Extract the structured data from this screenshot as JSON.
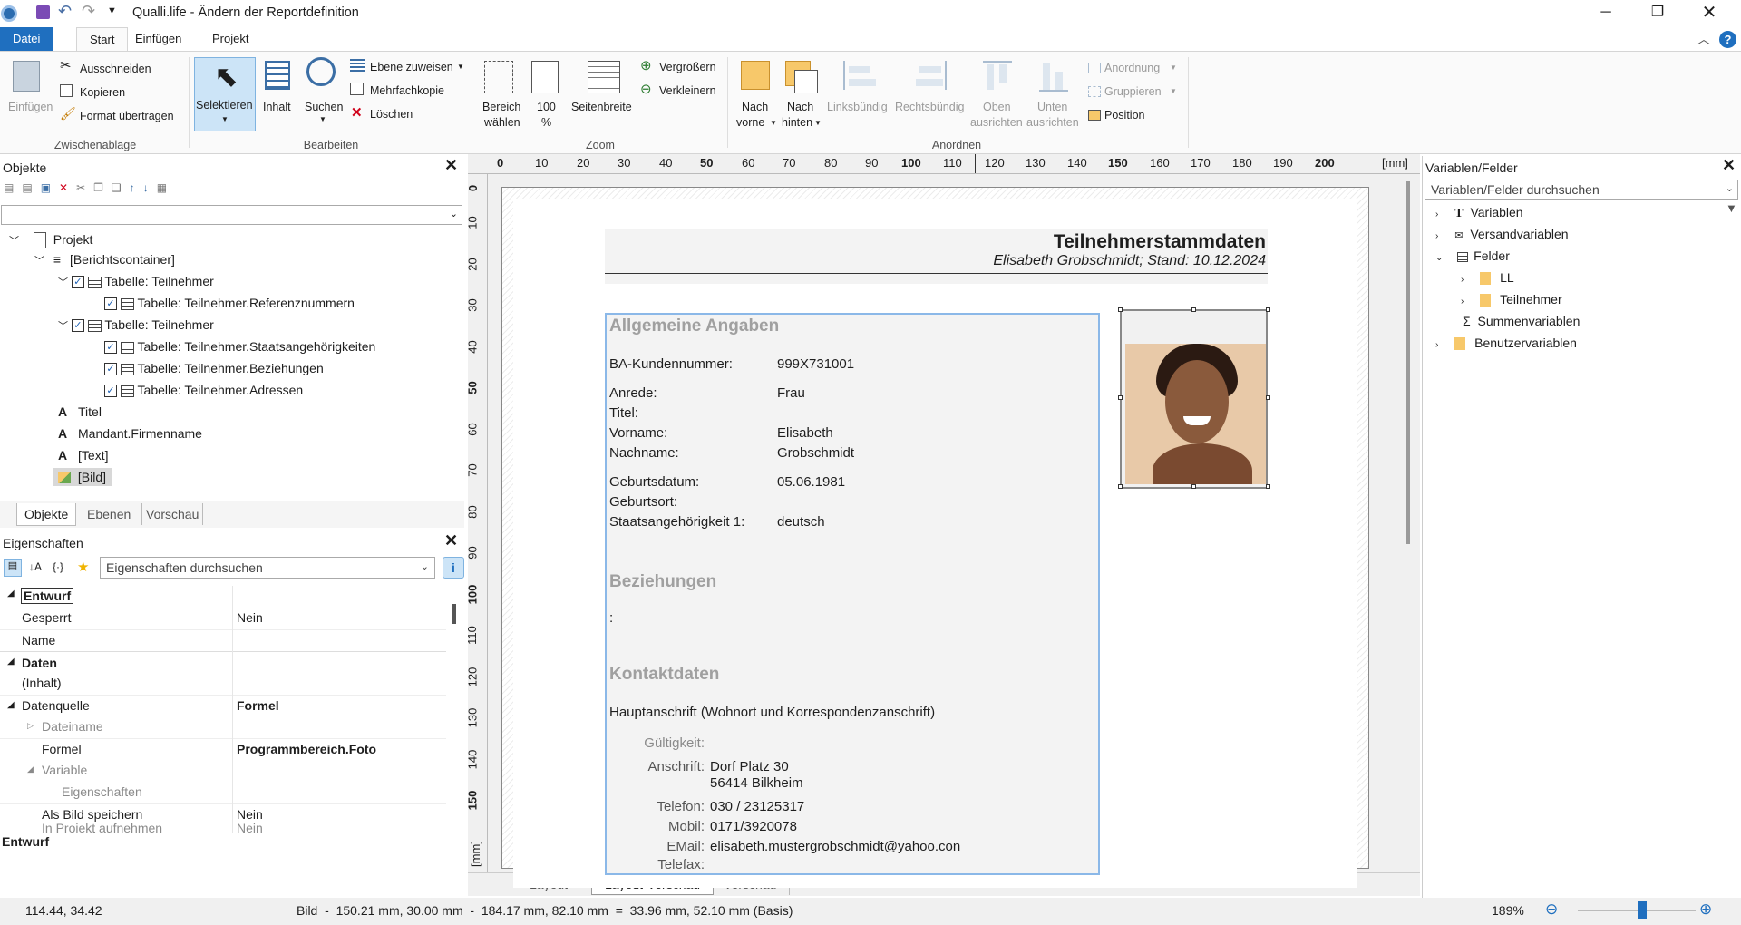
{
  "window": {
    "title": "Qualli.life - Ändern der Reportdefinition"
  },
  "tabs": [
    "Datei",
    "Start",
    "Einfügen",
    "Projekt"
  ],
  "ribbon": {
    "clipboard": {
      "paste": "Einfügen",
      "cut": "Ausschneiden",
      "copy": "Kopieren",
      "format": "Format übertragen",
      "group": "Zwischenablage"
    },
    "edit": {
      "select": "Selektieren",
      "content": "Inhalt",
      "search": "Suchen",
      "assign_layer": "Ebene zuweisen",
      "multi_copy": "Mehrfachkopie",
      "delete": "Löschen",
      "group": "Bearbeiten"
    },
    "zoom": {
      "area1": "Bereich",
      "area2": "wählen",
      "pct1": "100",
      "pct2": "%",
      "pagewidth": "Seitenbreite",
      "zoomin": "Vergrößern",
      "zoomout": "Verkleinern",
      "group": "Zoom"
    },
    "arrange": {
      "front1": "Nach",
      "front2": "vorne",
      "back1": "Nach",
      "back2": "hinten",
      "left": "Linksbündig",
      "right": "Rechtsbündig",
      "top1": "Oben",
      "top2": "ausrichten",
      "bottom1": "Unten",
      "bottom2": "ausrichten",
      "arrangement": "Anordnung",
      "grouping": "Gruppieren",
      "position": "Position",
      "group": "Anordnen"
    }
  },
  "objects": {
    "title": "Objekte",
    "tree": [
      "Projekt",
      "[Berichtscontainer]",
      "Tabelle: Teilnehmer",
      "Tabelle: Teilnehmer.Referenznummern",
      "Tabelle: Teilnehmer",
      "Tabelle: Teilnehmer.Staatsangehörigkeiten",
      "Tabelle: Teilnehmer.Beziehungen",
      "Tabelle: Teilnehmer.Adressen",
      "Titel",
      "Mandant.Firmenname",
      "[Text]",
      "[Bild]"
    ],
    "tabs": [
      "Objekte",
      "Ebenen",
      "Vorschau"
    ]
  },
  "properties": {
    "title": "Eigenschaften",
    "search_placeholder": "Eigenschaften durchsuchen",
    "rows": [
      {
        "k": "Entwurf",
        "v": ""
      },
      {
        "k": "Gesperrt",
        "v": "Nein"
      },
      {
        "k": "Name",
        "v": ""
      },
      {
        "k": "Daten",
        "v": ""
      },
      {
        "k": "(Inhalt)",
        "v": ""
      },
      {
        "k": "Datenquelle",
        "v": "Formel"
      },
      {
        "k": "Dateiname",
        "v": ""
      },
      {
        "k": "Formel",
        "v": "Programmbereich.Foto"
      },
      {
        "k": "Variable",
        "v": ""
      },
      {
        "k": "Eigenschaften",
        "v": ""
      },
      {
        "k": "Als Bild speichern",
        "v": "Nein"
      },
      {
        "k": "In Projekt aufnehmen",
        "v": "Nein"
      }
    ],
    "footer": "Entwurf"
  },
  "ruler": {
    "unit": "[mm]",
    "h": [
      "0",
      "10",
      "20",
      "30",
      "40",
      "50",
      "60",
      "70",
      "80",
      "90",
      "100",
      "110",
      "120",
      "130",
      "140",
      "150",
      "160",
      "170",
      "180",
      "190",
      "200"
    ],
    "v": [
      "0",
      "10",
      "20",
      "30",
      "40",
      "50",
      "60",
      "70",
      "80",
      "90",
      "100",
      "110",
      "120",
      "130",
      "140",
      "150"
    ]
  },
  "report": {
    "title": "Teilnehmerstammdaten",
    "subtitle": "Elisabeth Grobschmidt; Stand: 10.12.2024",
    "sec1": "Allgemeine Angaben",
    "fields": [
      {
        "k": "BA-Kundennummer:",
        "v": "999X731001"
      },
      {
        "k": "Anrede:",
        "v": "Frau"
      },
      {
        "k": "Titel:",
        "v": ""
      },
      {
        "k": "Vorname:",
        "v": "Elisabeth"
      },
      {
        "k": "Nachname:",
        "v": "Grobschmidt"
      },
      {
        "k": "Geburtsdatum:",
        "v": "05.06.1981"
      },
      {
        "k": "Geburtsort:",
        "v": ""
      },
      {
        "k": "Staatsangehörigkeit 1:",
        "v": "deutsch"
      }
    ],
    "sec2": "Beziehungen",
    "colon": ":",
    "sec3": "Kontaktdaten",
    "address_type": "Hauptanschrift (Wohnort und Korrespondenzanschrift)",
    "contact": [
      {
        "k": "Gültigkeit:",
        "v": ""
      },
      {
        "k": "Anschrift:",
        "v": "Dorf Platz 30"
      },
      {
        "k": "",
        "v": "56414 Bilkheim"
      },
      {
        "k": "Telefon:",
        "v": "030 / 23125317"
      },
      {
        "k": "Mobil:",
        "v": "0171/3920078"
      },
      {
        "k": "EMail:",
        "v": "elisabeth.mustergrobschmidt@yahoo.con"
      },
      {
        "k": "Telefax:",
        "v": ""
      }
    ]
  },
  "bottom_tabs": [
    "Layout",
    "Layout-Vorschau",
    "Vorschau"
  ],
  "variables": {
    "title": "Variablen/Felder",
    "search_placeholder": "Variablen/Felder durchsuchen",
    "tree": [
      "Variablen",
      "Versandvariablen",
      "Felder",
      "LL",
      "Teilnehmer",
      "Summenvariablen",
      "Benutzervariablen"
    ]
  },
  "status": {
    "coords": "114.44, 34.42",
    "info": "Bild  -  150.21 mm, 30.00 mm  -  184.17 mm, 82.10 mm  =  33.96 mm, 52.10 mm (Basis)",
    "zoom": "189%"
  }
}
